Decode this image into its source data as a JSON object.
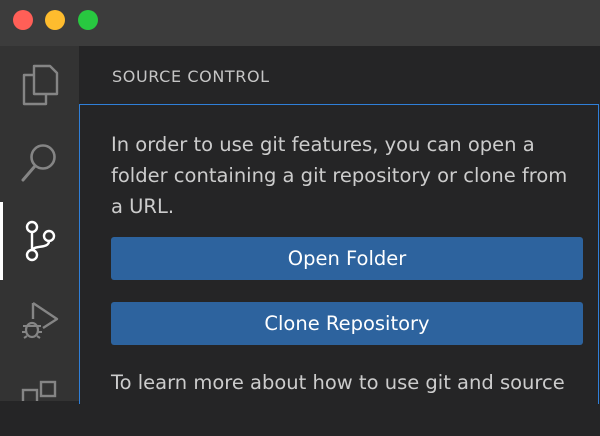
{
  "window": {
    "traffic_lights": {
      "close": "#ff5f57",
      "minimize": "#febc2e",
      "maximize": "#28c840"
    }
  },
  "activity_bar": {
    "items": [
      {
        "icon": "explorer-icon"
      },
      {
        "icon": "search-icon"
      },
      {
        "icon": "source-control-icon",
        "active": true
      },
      {
        "icon": "run-debug-icon"
      },
      {
        "icon": "extensions-icon"
      }
    ]
  },
  "sidebar": {
    "title": "SOURCE CONTROL",
    "message": "In order to use git features, you can open a folder containing a git repository or clone from a URL.",
    "open_folder_label": "Open Folder",
    "clone_repository_label": "Clone Repository",
    "learn_more_text": "To learn more about how to use git and source"
  },
  "colors": {
    "accent": "#2f7fd8",
    "button": "#2d639e"
  }
}
